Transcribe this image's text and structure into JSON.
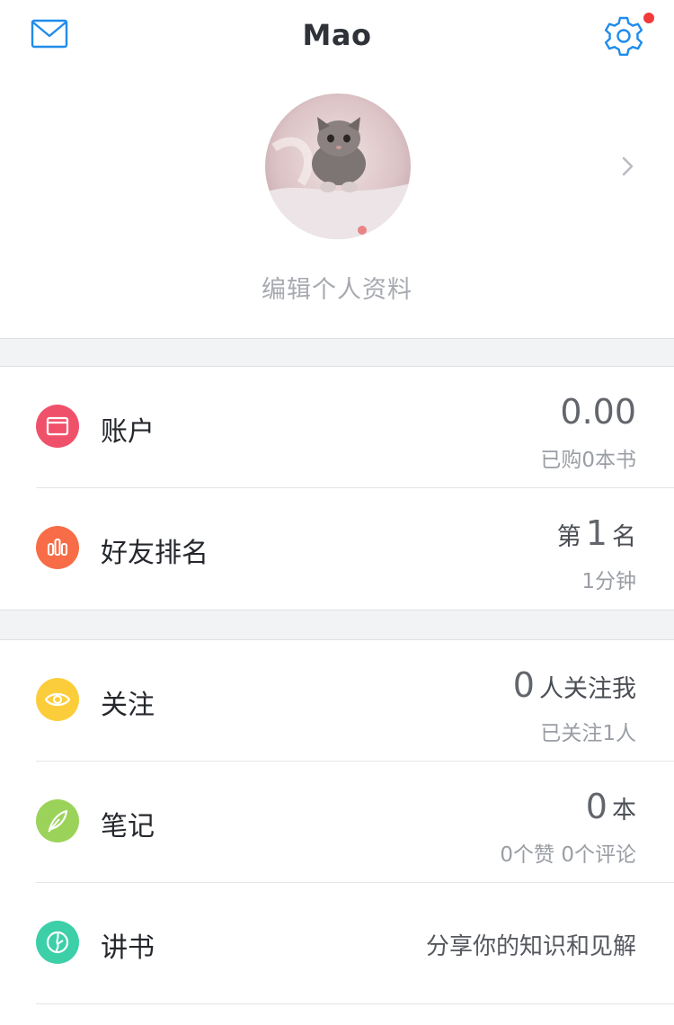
{
  "header": {
    "title": "Mao",
    "mail_icon": "mail-icon",
    "settings_icon": "gear-icon",
    "has_notification": true
  },
  "profile": {
    "avatar": "cat-photo-avatar",
    "edit_label": "编辑个人资料"
  },
  "section_account": {
    "account": {
      "label": "账户",
      "value": "0.00",
      "sub": "已购0本书",
      "icon": "wallet-icon",
      "color": "#f0516a"
    },
    "ranking": {
      "label": "好友排名",
      "prefix": "第",
      "rank": "1",
      "suffix": "名",
      "sub": "1分钟",
      "icon": "bar-chart-icon",
      "color": "#f86d47"
    }
  },
  "section_social": {
    "follow": {
      "label": "关注",
      "count": "0",
      "count_text": "人关注我",
      "sub": "已关注1人",
      "icon": "eye-icon",
      "color": "#fccd3b"
    },
    "notes": {
      "label": "笔记",
      "count": "0",
      "count_text": "本",
      "sub": "0个赞 0个评论",
      "icon": "feather-icon",
      "color": "#9bd35a"
    },
    "lecture": {
      "label": "讲书",
      "value": "分享你的知识和见解",
      "icon": "lecture-icon",
      "color": "#3dcfa8"
    }
  },
  "colors": {
    "accent_blue": "#1f8ceb",
    "notification_red": "#f23a3a",
    "separator_bg": "#f2f3f5"
  }
}
